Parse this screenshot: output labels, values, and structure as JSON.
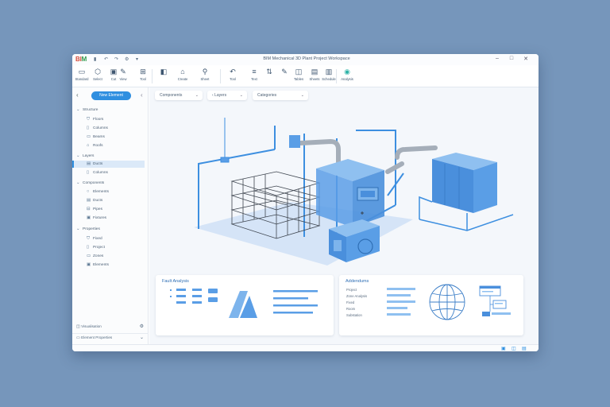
{
  "window": {
    "title": "BIM Mechanical 3D Plant Project Workspace",
    "logo_part1": "BI",
    "logo_part2": "M",
    "quick_icons": [
      "save-icon",
      "undo-icon",
      "redo-icon",
      "settings-icon"
    ],
    "controls": {
      "minimize": "–",
      "maximize": "□",
      "close": "✕"
    }
  },
  "ribbon": {
    "buttons": [
      {
        "icon": "▭",
        "label": "Standard"
      },
      {
        "icon": "⬡",
        "label": "Select"
      },
      {
        "icon": "▣",
        "label": "Cut"
      },
      {
        "icon": "✎",
        "label": "View"
      },
      {
        "icon": "⊞",
        "label": "Tool"
      },
      {
        "icon": "◧",
        "label": ""
      },
      {
        "icon": "⌂",
        "label": "Create"
      },
      {
        "icon": "⚲",
        "label": "Sheet"
      },
      {
        "icon": "↶",
        "label": "Tool"
      },
      {
        "icon": "≡",
        "label": "Text"
      },
      {
        "icon": "⇅",
        "label": ""
      },
      {
        "icon": "✎",
        "label": ""
      },
      {
        "icon": "◫",
        "label": "Tables"
      },
      {
        "icon": "▤",
        "label": "Sheets"
      },
      {
        "icon": "▥",
        "label": "Schedule"
      },
      {
        "icon": "◉",
        "label": "Analysis"
      }
    ]
  },
  "sidebar": {
    "primary_button": "New Element",
    "groups": [
      {
        "label": "Structure",
        "items": [
          "Floors",
          "Columns",
          "Beams",
          "Roofs"
        ]
      },
      {
        "label": "Layers",
        "items": [
          "Ducts",
          "Columns"
        ],
        "selected": 0
      },
      {
        "label": "Components",
        "items": [
          "Elements",
          "Ducts",
          "Pipes",
          "Fixtures"
        ]
      },
      {
        "label": "Properties",
        "items": [
          "Fixed",
          "Project",
          "Zones",
          "Elements"
        ]
      }
    ],
    "footer": [
      {
        "label": "Visualisation",
        "icon": "⚙"
      },
      {
        "label": "Element Properties",
        "icon": "⌄"
      }
    ]
  },
  "main": {
    "dropdowns": [
      "Components",
      "Layers",
      "Categories"
    ],
    "panels": {
      "left": {
        "title": "Fault Analysis"
      },
      "right": {
        "title": "Addendums",
        "labels": [
          "Project",
          "Zone Analysis",
          "Fixed",
          "Room",
          "Substation"
        ]
      }
    }
  },
  "colors": {
    "accent": "#2f8fe0",
    "background": "#7696bb",
    "model_blue": "#5a9ee6"
  }
}
